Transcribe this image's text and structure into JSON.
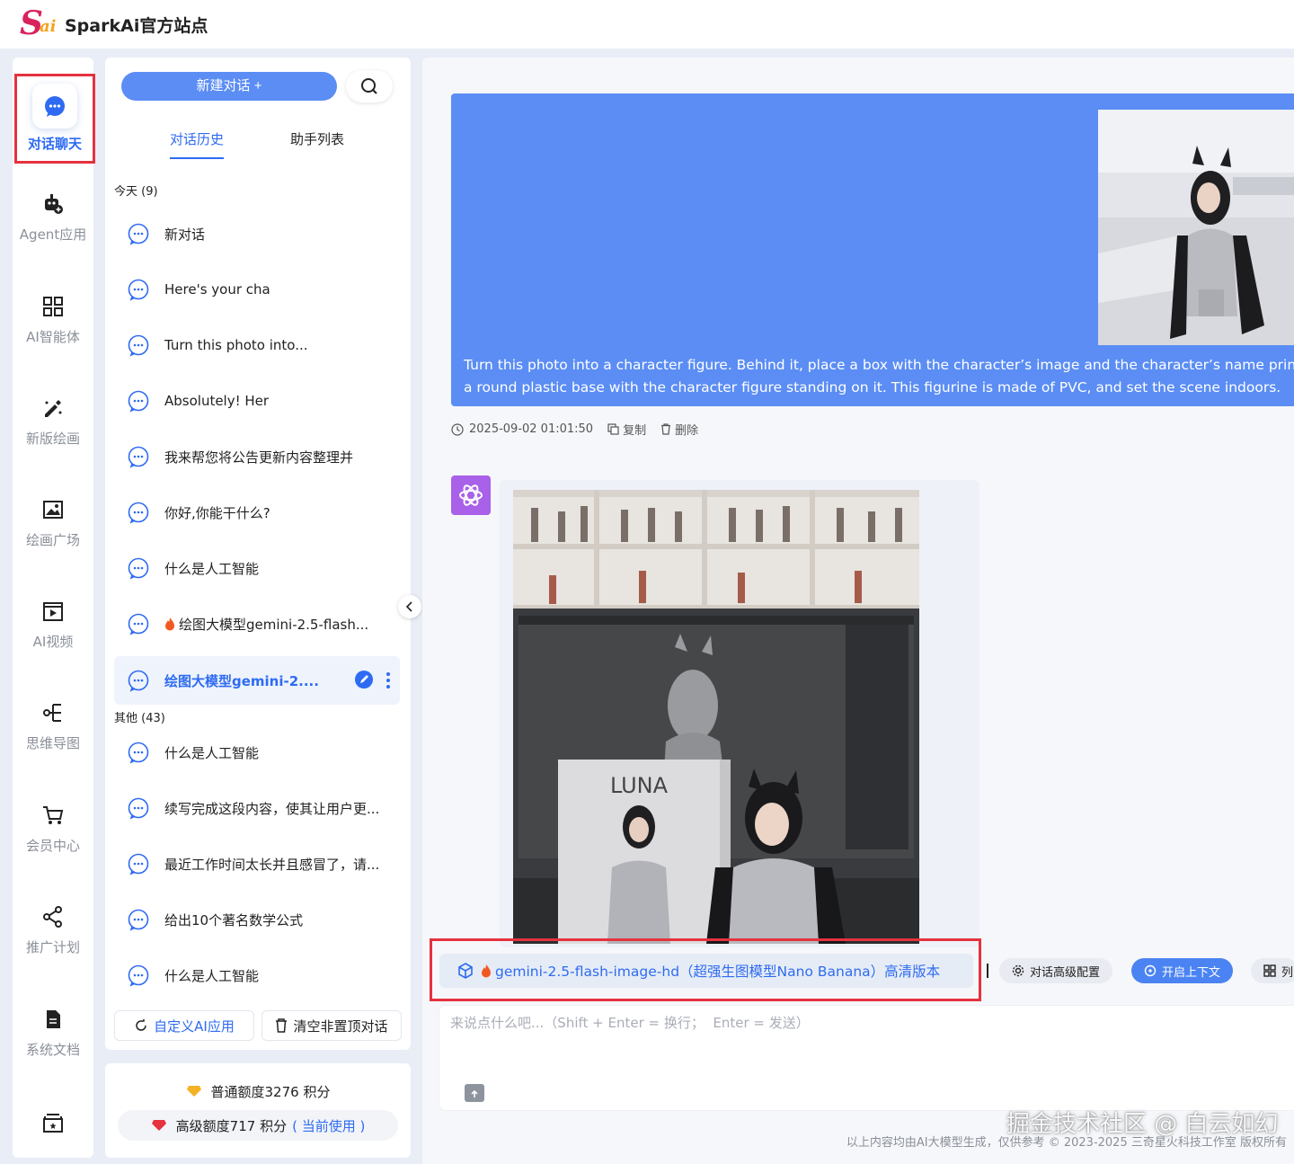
{
  "header": {
    "site_name": "SparkAi官方站点"
  },
  "rail": [
    {
      "label": "对话聊天",
      "icon": "chat-bubble-icon"
    },
    {
      "label": "Agent应用",
      "icon": "robot-icon"
    },
    {
      "label": "AI智能体",
      "icon": "grid-icon"
    },
    {
      "label": "新版绘画",
      "icon": "paint-brush-icon"
    },
    {
      "label": "绘画广场",
      "icon": "gallery-icon"
    },
    {
      "label": "AI视频",
      "icon": "video-icon"
    },
    {
      "label": "思维导图",
      "icon": "mindmap-icon"
    },
    {
      "label": "会员中心",
      "icon": "cart-icon"
    },
    {
      "label": "推广计划",
      "icon": "share-icon"
    },
    {
      "label": "系统文档",
      "icon": "document-icon"
    }
  ],
  "convo": {
    "new_chat": "新建对话 +",
    "tabs": [
      "对话历史",
      "助手列表"
    ],
    "today_group": "今天 (9)",
    "today_items": [
      "新对话",
      "Here's your cha",
      "Turn this photo into...",
      "Absolutely! Her",
      "我来帮您将公告更新内容整理并",
      "你好,你能干什么?",
      "什么是人工智能",
      "绘图大模型gemini-2.5-flash...",
      "绘图大模型gemini-2...."
    ],
    "other_group": "其他 (43)",
    "other_items": [
      "什么是人工智能",
      "续写完成这段内容，使其让用户更...",
      "最近工作时间太长并且感冒了，请...",
      "给出10个著名数学公式",
      "什么是人工智能"
    ],
    "custom_app": "自定义AI应用",
    "clear_chats": "清空非置顶对话"
  },
  "credits": {
    "normal": "普通额度3276 积分",
    "premium": "高级额度717 积分",
    "current": "( 当前使用 )"
  },
  "chat": {
    "user_text_line1": "Turn this photo into a character figure. Behind it, place a box with the character’s image and the character’s name printed o",
    "user_text_line2": "a round plastic base with the character figure standing on it. This figurine is made of PVC, and set the scene indoors.",
    "timestamp": "2025-09-02 01:01:50",
    "copy": "复制",
    "delete": "删除",
    "box_brand": "LUNA"
  },
  "toolbar": {
    "model": "gemini-2.5-flash-image-hd（超强生图模型Nano Banana）高清版本",
    "advanced": "对话高级配置",
    "context": "开启上下文",
    "more": "列"
  },
  "input": {
    "placeholder": "来说点什么吧...（Shift + Enter = 换行；  Enter = 发送）"
  },
  "watermark": "掘金技术社区 @ 白云如幻",
  "footer": "以上内容均由AI大模型生成，仅供参考  © 2023-2025 三奇星火科技工作室  版权所有",
  "colors": {
    "accent": "#2e6bf2",
    "user_bubble": "#5b8df4",
    "highlight_border": "#e5323e",
    "bot_avatar": "#a861e8"
  }
}
